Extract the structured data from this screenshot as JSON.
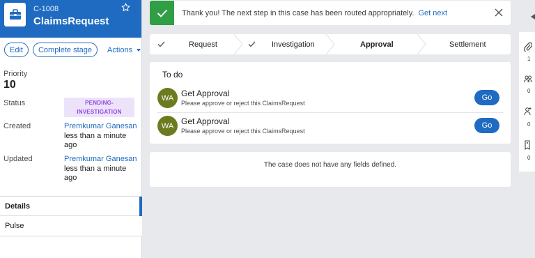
{
  "case": {
    "id": "C-1008",
    "title": "ClaimsRequest",
    "icon": "briefcase-icon"
  },
  "header_actions": {
    "edit_label": "Edit",
    "complete_stage_label": "Complete stage",
    "actions_label": "Actions"
  },
  "summary": {
    "priority_label": "Priority",
    "priority_value": "10",
    "status_label": "Status",
    "status_value_line1": "PENDING-",
    "status_value_line2": "INVESTIGATION",
    "created_label": "Created",
    "created_by": "Premkumar Ganesan",
    "created_time": "less than a minute ago",
    "updated_label": "Updated",
    "updated_by": "Premkumar Ganesan",
    "updated_time": "less than a minute ago"
  },
  "nav": {
    "details_label": "Details",
    "pulse_label": "Pulse"
  },
  "notification": {
    "message": "Thank you! The next step in this case has been routed appropriately.",
    "link_label": "Get next"
  },
  "stages": [
    {
      "label": "Request",
      "state": "completed"
    },
    {
      "label": "Investigation",
      "state": "completed"
    },
    {
      "label": "Approval",
      "state": "active"
    },
    {
      "label": "Settlement",
      "state": "upcoming"
    }
  ],
  "todo": {
    "title": "To do",
    "items": [
      {
        "initials": "WA",
        "title": "Get Approval",
        "subtitle": "Please approve or reject this ClaimsRequest",
        "button": "Go"
      },
      {
        "initials": "WA",
        "title": "Get Approval",
        "subtitle": "Please approve or reject this ClaimsRequest",
        "button": "Go"
      }
    ]
  },
  "fields_message": "The case does not have any fields defined.",
  "utilities": [
    {
      "icon": "paperclip-icon",
      "count": "1"
    },
    {
      "icon": "followers-icon",
      "count": "0"
    },
    {
      "icon": "stakeholder-icon",
      "count": "0"
    },
    {
      "icon": "tag-icon",
      "count": "0"
    }
  ],
  "colors": {
    "brand": "#1f6bc1",
    "success": "#2f9e44",
    "status_bg": "#ece3fb",
    "status_text": "#9348e0",
    "avatar": "#6b7b1e"
  }
}
